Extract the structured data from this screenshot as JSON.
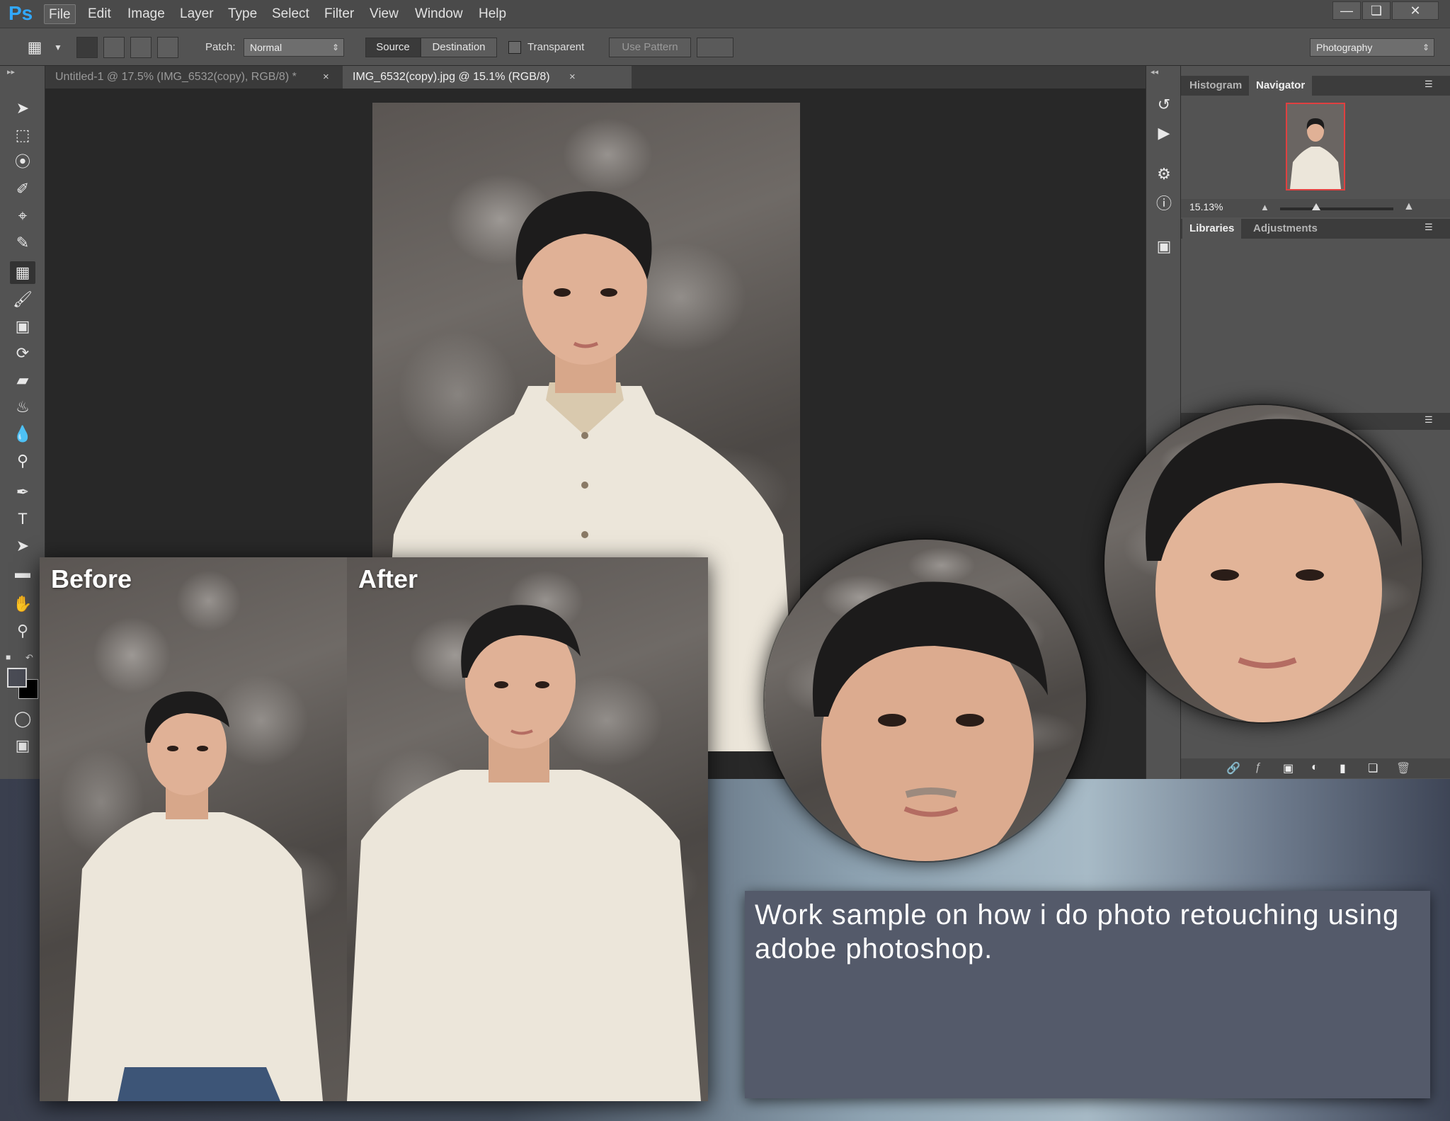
{
  "app": {
    "logo": "Ps",
    "menu": [
      "File",
      "Edit",
      "Image",
      "Layer",
      "Type",
      "Select",
      "Filter",
      "View",
      "Window",
      "Help"
    ],
    "window_controls": [
      "minimize-icon",
      "restore-icon",
      "close-icon"
    ]
  },
  "options": {
    "patch_label": "Patch:",
    "patch_value": "Normal",
    "source_label": "Source",
    "destination_label": "Destination",
    "transparent_label": "Transparent",
    "use_pattern_label": "Use Pattern",
    "workspace_value": "Photography"
  },
  "documents": {
    "tabs": [
      {
        "title": "Untitled-1 @ 17.5% (IMG_6532(copy), RGB/8) *",
        "active": false
      },
      {
        "title": "IMG_6532(copy).jpg @ 15.1% (RGB/8)",
        "active": true
      }
    ],
    "close_glyph": "×"
  },
  "tools": [
    "move-icon",
    "marquee-icon",
    "lasso-icon",
    "quick-select-icon",
    "crop-icon",
    "eyedropper-icon",
    "patch-icon",
    "brush-icon",
    "stamp-icon",
    "history-brush-icon",
    "eraser-icon",
    "paint-bucket-icon",
    "blur-icon",
    "dodge-icon",
    "pen-icon",
    "type-icon",
    "path-select-icon",
    "rectangle-icon",
    "hand-icon",
    "zoom-icon"
  ],
  "panels": {
    "top_tabs": [
      "Histogram",
      "Navigator"
    ],
    "active_top_tab": "Navigator",
    "zoom_value": "15.13%",
    "zoom_level_fraction": 0.32,
    "bottom_tabs": [
      "Libraries",
      "Adjustments"
    ]
  },
  "comparison": {
    "before_label": "Before",
    "after_label": "After"
  },
  "caption": "Work sample on how i do photo retouching using adobe photoshop.",
  "colors": {
    "ps_blue": "#31a8ff",
    "ui_gray": "#535353",
    "canvas_dark": "#282828",
    "caption_box": "#545a6a",
    "navigator_frame": "#e04040"
  }
}
